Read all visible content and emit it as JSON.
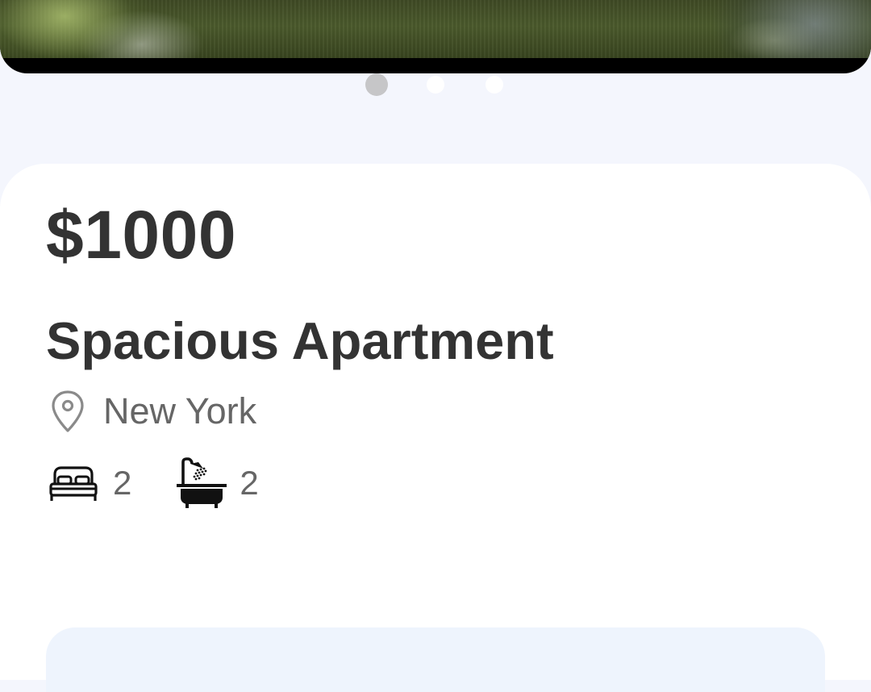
{
  "gallery": {
    "image_alt": "",
    "slide_count": 3,
    "active_index": 0
  },
  "listing": {
    "price": "$1000",
    "title": "Spacious Apartment",
    "location": "New York",
    "bedrooms": "2",
    "bathrooms": "2"
  },
  "icons": {
    "location": "map-pin-icon",
    "bedrooms": "bed-icon",
    "bathrooms": "bathtub-icon"
  },
  "colors": {
    "background": "#f4f6fd",
    "card": "#ffffff",
    "primary_text": "#333333",
    "secondary_text": "#666666",
    "dot_active": "#c6c6c8",
    "dot_inactive": "#ffffff",
    "bottom_panel": "#eef4fd"
  }
}
